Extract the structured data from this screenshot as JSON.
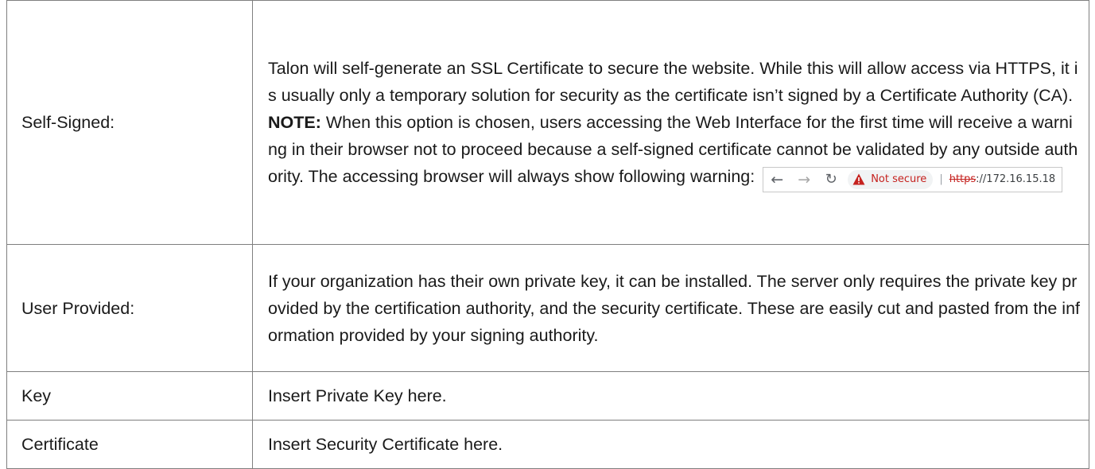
{
  "rows": {
    "self_signed": {
      "label": "Self-Signed:",
      "intro": "Talon will self-generate an SSL Certificate to secure the website. While this will allow access via HTTPS, it is usually only a temporary solution for security as the certificate isn’t signed by a Certificate Authority (CA).",
      "note_label": "NOTE:",
      "note_text": " When this option is chosen, users accessing the Web Interface for the first time will receive a warning in their browser not to proceed because a self-signed certificate cannot be validated by any outside authority.  The accessing browser will always show following warning: ",
      "address_bar": {
        "back_icon": "back-arrow-icon",
        "forward_icon": "forward-arrow-icon",
        "reload_icon": "reload-icon",
        "warning_icon": "warning-triangle-icon",
        "warning_color": "#c5221f",
        "not_secure": "Not secure",
        "separator": "|",
        "scheme": "https",
        "url_rest": "://172.16.15.18"
      }
    },
    "user_provided": {
      "label": "User Provided:",
      "text": "If your organization has their own private key, it can be installed. The server only requires the private key provided by the certification authority, and the security certificate. These are easily cut and pasted from the information provided by your signing authority."
    },
    "key": {
      "label": "Key",
      "text": "Insert Private Key here."
    },
    "certificate": {
      "label": "Certificate",
      "text": "Insert Security Certificate here."
    }
  }
}
